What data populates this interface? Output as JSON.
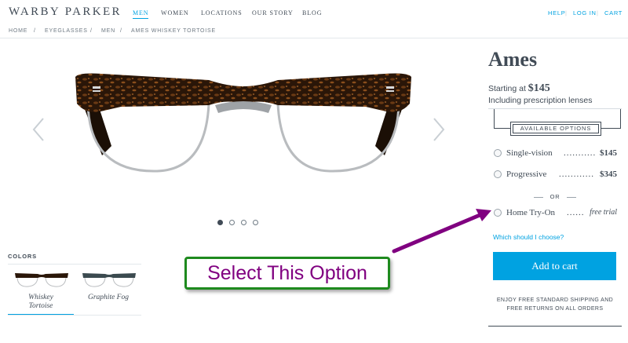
{
  "header": {
    "logo": "WARBY PARKER",
    "nav": [
      "MEN",
      "WOMEN",
      "LOCATIONS",
      "OUR STORY",
      "BLOG"
    ],
    "nav_active": "MEN",
    "utility": {
      "help": "HELP",
      "login": "LOG IN",
      "cart": "CART",
      "separator": "|"
    }
  },
  "breadcrumb": {
    "items": [
      "HOME",
      "EYEGLASSES",
      "MEN",
      "AMES WHISKEY TORTOISE"
    ],
    "separator": "/"
  },
  "gallery": {
    "dots": 4,
    "active_dot": 1
  },
  "colors": {
    "label": "COLORS",
    "swatches": [
      {
        "name": "Whiskey Tortoise",
        "line1": "Whiskey",
        "line2": "Tortoise",
        "selected": true
      },
      {
        "name": "Graphite Fog",
        "line1": "Graphite Fog",
        "line2": "",
        "selected": false
      }
    ]
  },
  "product": {
    "name": "Ames",
    "starting_prefix": "Starting at",
    "starting_price": "$145",
    "including": "Including prescription lenses",
    "options_label": "AVAILABLE OPTIONS",
    "options": [
      {
        "label": "Single-vision",
        "dots": "...........",
        "price": "$145"
      },
      {
        "label": "Progressive",
        "dots": "............",
        "price": "$345"
      }
    ],
    "or_label": "OR",
    "home_tryon": {
      "label": "Home Try-On",
      "dots": "......",
      "note": "free trial"
    },
    "which_link": "Which should I choose?",
    "add_to_cart": "Add to cart",
    "shipping_line1": "ENJOY FREE STANDARD SHIPPING AND",
    "shipping_line2": "FREE RETURNS ON ALL ORDERS"
  },
  "annotation": {
    "text": "Select This Option",
    "text_color": "#800080",
    "border_color": "#1e8a1e",
    "arrow_color": "#800080"
  },
  "colors_theme": {
    "accent": "#00a2e1",
    "text": "#414b56"
  }
}
